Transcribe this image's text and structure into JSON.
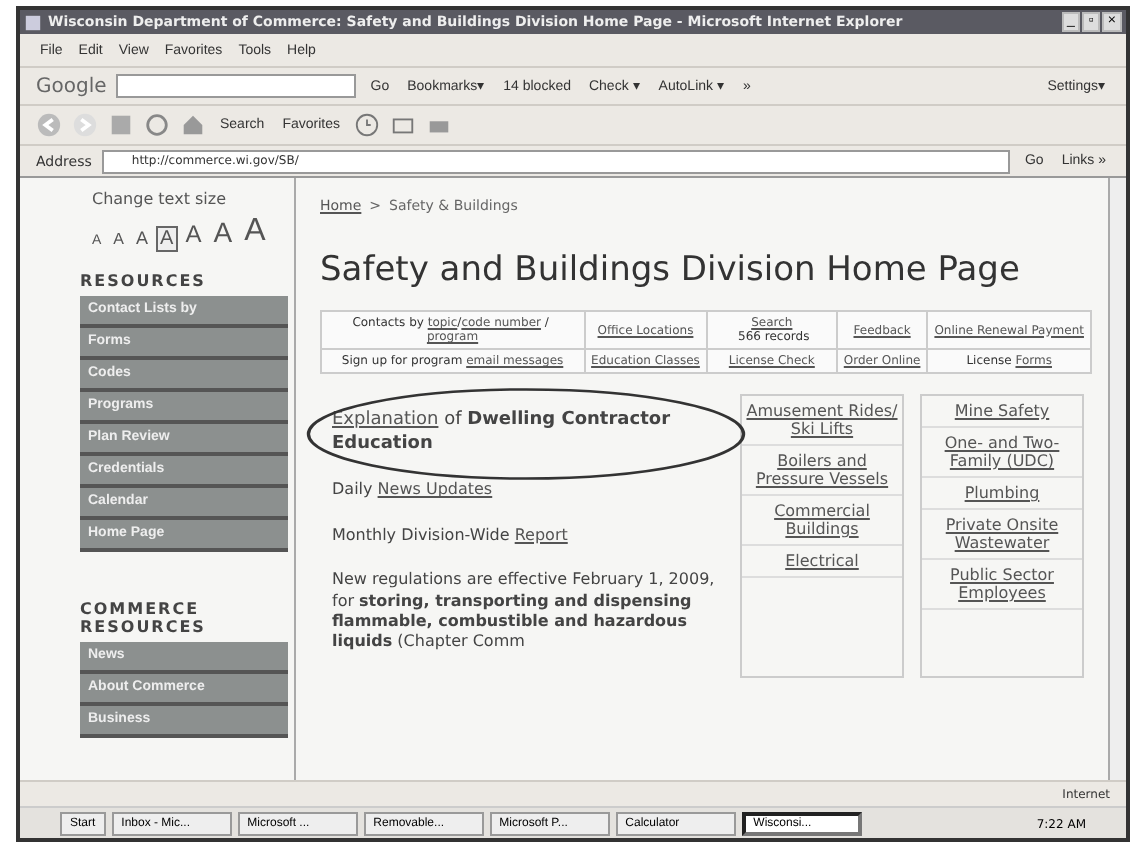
{
  "window": {
    "title": "Wisconsin Department of Commerce: Safety and Buildings Division Home Page - Microsoft Internet Explorer",
    "controls": [
      "_",
      "▫",
      "×"
    ]
  },
  "menu": [
    "File",
    "Edit",
    "View",
    "Favorites",
    "Tools",
    "Help"
  ],
  "google_toolbar": {
    "logo": "Google",
    "items": [
      "Go",
      "Bookmarks▾",
      "14 blocked",
      "Check ▾",
      "AutoLink ▾",
      "»"
    ],
    "settings": "Settings▾"
  },
  "nav_toolbar": {
    "items": [
      "Search",
      "Favorites"
    ]
  },
  "address_bar": {
    "label": "Address",
    "value": "http://commerce.wi.gov/SB/",
    "go": "Go",
    "links": "Links »"
  },
  "sidebar": {
    "text_size_label": "Change text size",
    "text_sizes": [
      {
        "label": "A",
        "selected": false
      },
      {
        "label": "A",
        "selected": false
      },
      {
        "label": "A",
        "selected": false
      },
      {
        "label": "A",
        "selected": true
      },
      {
        "label": "A",
        "selected": false
      },
      {
        "label": "A",
        "selected": false
      },
      {
        "label": "A",
        "selected": false
      }
    ],
    "sections": [
      {
        "heading": "RESOURCES",
        "items": [
          "Contact Lists by",
          "Forms",
          "Codes",
          "Programs",
          "Plan Review",
          "Credentials",
          "Calendar",
          "Home Page"
        ]
      },
      {
        "heading": "COMMERCE RESOURCES",
        "items": [
          "News",
          "About Commerce",
          "Business"
        ]
      }
    ]
  },
  "breadcrumb": [
    {
      "text": "Home",
      "link": true
    },
    {
      "text": ">",
      "link": false
    },
    {
      "text": "Safety & Buildings",
      "link": false
    }
  ],
  "heading": "Safety and Buildings Division Home Page",
  "quick_links": [
    [
      [
        {
          "text": "Contacts by ",
          "link": false
        },
        {
          "text": "topic",
          "link": true
        },
        {
          "text": "/",
          "link": false
        },
        {
          "text": "code number",
          "link": true
        },
        {
          "text": " / ",
          "link": false
        },
        {
          "text": "program",
          "link": true
        }
      ],
      [
        {
          "text": "Office Locations",
          "link": true
        }
      ],
      [
        {
          "text": "Search",
          "link": true
        },
        {
          "text": " 566 records",
          "link": false
        }
      ],
      [
        {
          "text": "Feedback",
          "link": true
        }
      ],
      [
        {
          "text": "Online Renewal Payment",
          "link": true
        }
      ]
    ],
    [
      [
        {
          "text": "Sign up for program ",
          "link": false
        },
        {
          "text": "email messages",
          "link": true
        }
      ],
      [
        {
          "text": "Education Classes",
          "link": true
        }
      ],
      [
        {
          "text": "License Check",
          "link": true
        }
      ],
      [
        {
          "text": "Order Online",
          "link": true
        }
      ],
      [
        {
          "text": "License ",
          "link": false
        },
        {
          "text": "Forms",
          "link": true
        }
      ]
    ]
  ],
  "paragraphs": [
    [
      {
        "text": "Explanation",
        "kind": "link"
      },
      {
        "text": " of ",
        "kind": "plain"
      },
      {
        "text": "Dwelling Contractor Education",
        "kind": "bold"
      }
    ],
    [
      {
        "text": "Daily ",
        "kind": "plain"
      },
      {
        "text": "News Updates",
        "kind": "link"
      }
    ],
    [
      {
        "text": "Monthly Division-Wide ",
        "kind": "plain"
      },
      {
        "text": "Report",
        "kind": "link"
      }
    ],
    [
      {
        "text": "New regulations are effective February 1, 2009, for **storing, transporting and dispensing flammable, combustible and hazardous liquids** (Chapter Comm",
        "kind": "rich"
      }
    ]
  ],
  "program_links": [
    [
      "Amusement Rides/ Ski Lifts",
      "Boilers and Pressure Vessels",
      "Commercial Buildings",
      "Electrical"
    ],
    [
      "Mine Safety",
      "One- and Two-Family (UDC)",
      "Plumbing",
      "Private Onsite Wastewater",
      "Public Sector Employees"
    ]
  ],
  "status_bar": {
    "zone": "Internet"
  },
  "taskbar": {
    "start": "Start",
    "tasks": [
      {
        "label": "Inbox - Mic...",
        "selected": false
      },
      {
        "label": "Microsoft ...",
        "selected": false
      },
      {
        "label": "Removable...",
        "selected": false
      },
      {
        "label": "Microsoft P...",
        "selected": false
      },
      {
        "label": "Calculator",
        "selected": false
      },
      {
        "label": "Wisconsi...",
        "selected": true
      }
    ],
    "time": "7:22 AM"
  }
}
